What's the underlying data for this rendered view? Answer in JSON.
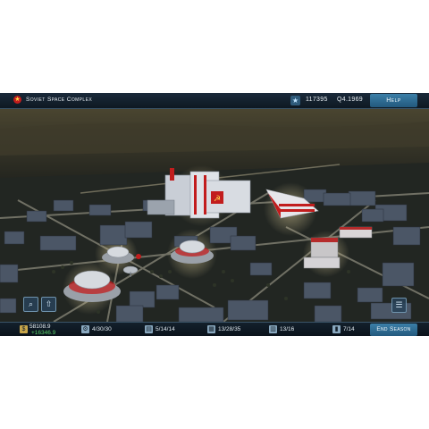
{
  "header": {
    "title": "Soviet Space Complex",
    "score": "117395",
    "date": "Q4.1969",
    "help_label": "Help"
  },
  "footer": {
    "money": "58108.9",
    "income": "+16346.9",
    "resources": [
      {
        "icon": "gear-icon",
        "value": "4/30/30"
      },
      {
        "icon": "document-icon",
        "value": "5/14/14"
      },
      {
        "icon": "factory-icon",
        "value": "13/28/35"
      },
      {
        "icon": "housing-icon",
        "value": "13/16"
      },
      {
        "icon": "rocket-icon",
        "value": "7/14"
      }
    ],
    "end_season_label": "End Season"
  },
  "colors": {
    "hud_bg": "#13202c",
    "button_blue": "#2f6d94",
    "income_green": "#59d26a",
    "soviet_red": "#c21d1d"
  }
}
